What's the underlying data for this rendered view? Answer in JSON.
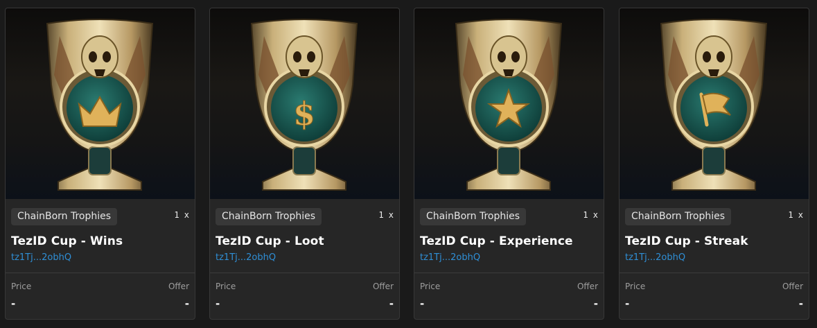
{
  "cards": [
    {
      "collection": "ChainBorn Trophies",
      "quantity": "1 x",
      "title": "TezID Cup - Wins",
      "owner": "tz1Tj...2obhQ",
      "price_label": "Price",
      "price_value": "-",
      "offer_label": "Offer",
      "offer_value": "-",
      "emblem": "crown-icon"
    },
    {
      "collection": "ChainBorn Trophies",
      "quantity": "1 x",
      "title": "TezID Cup - Loot",
      "owner": "tz1Tj...2obhQ",
      "price_label": "Price",
      "price_value": "-",
      "offer_label": "Offer",
      "offer_value": "-",
      "emblem": "dollar-icon"
    },
    {
      "collection": "ChainBorn Trophies",
      "quantity": "1 x",
      "title": "TezID Cup - Experience",
      "owner": "tz1Tj...2obhQ",
      "price_label": "Price",
      "price_value": "-",
      "offer_label": "Offer",
      "offer_value": "-",
      "emblem": "star-icon"
    },
    {
      "collection": "ChainBorn Trophies",
      "quantity": "1 x",
      "title": "TezID Cup - Streak",
      "owner": "tz1Tj...2obhQ",
      "price_label": "Price",
      "price_value": "-",
      "offer_label": "Offer",
      "offer_value": "-",
      "emblem": "flag-icon"
    }
  ],
  "colors": {
    "page_bg": "#1a1a1a",
    "card_bg": "#262626",
    "owner_link": "#2f8fd6",
    "emblem_gold": "#e0b25a",
    "medallion_teal": "#1e5f58"
  }
}
